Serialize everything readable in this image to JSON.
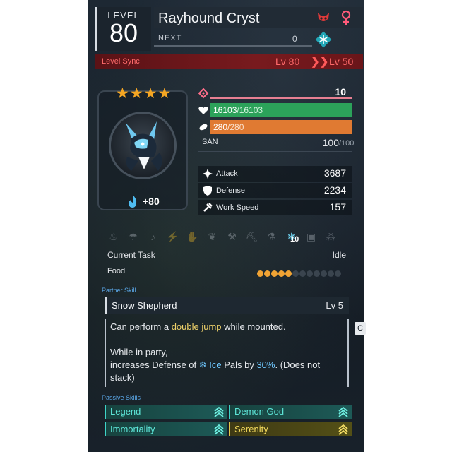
{
  "header": {
    "level_label": "LEVEL",
    "level": "80",
    "name": "Rayhound Cryst",
    "next_label": "NEXT",
    "next_value": "0",
    "element_icon": "ice-element-icon",
    "gender_icon": "female-icon",
    "type_icon": "aggressive-demon-icon"
  },
  "level_sync": {
    "label": "Level Sync",
    "from": "Lv 80",
    "to": "Lv 50",
    "arrow": "❯❯"
  },
  "portrait": {
    "stars": "★★★★",
    "soul_bonus": "+80"
  },
  "stats": {
    "trust_value": "10",
    "hp_current": "16103",
    "hp_max": "/16103",
    "food_current": "280",
    "food_max": "/280",
    "san_label": "SAN",
    "san_current": "100",
    "san_max": "/100",
    "attack_label": "Attack",
    "attack_value": "3687",
    "defense_label": "Defense",
    "defense_value": "2234",
    "work_speed_label": "Work Speed",
    "work_speed_value": "157"
  },
  "work": {
    "active_level": "10",
    "current_task_label": "Current Task",
    "current_task_value": "Idle",
    "food_label": "Food",
    "food_filled": 5,
    "food_total": 12
  },
  "partner_skill": {
    "section_title": "Partner Skill",
    "name": "Snow Shepherd",
    "level": "Lv  5",
    "desc_1a": "Can perform a ",
    "desc_1b": "double jump",
    "desc_1c": " while mounted.",
    "desc_2": "While in party,",
    "desc_3a": "increases Defense of ",
    "desc_3b": "Ice",
    "desc_3c": " Pals by ",
    "desc_3d": "30%",
    "desc_3e": ".  (Does not",
    "desc_4": "stack)"
  },
  "passive_skills": {
    "section_title": "Passive Skills",
    "items": [
      {
        "name": "Legend",
        "tier": "blue"
      },
      {
        "name": "Demon God",
        "tier": "blue"
      },
      {
        "name": "Immortality",
        "tier": "blue"
      },
      {
        "name": "Serenity",
        "tier": "gold"
      }
    ]
  },
  "side_tab_label": "C",
  "colors": {
    "hp": "#2ca25a",
    "food": "#e07a32",
    "level_sync": "#781a1e",
    "ice_accent": "#6fc8ff",
    "rare_passive": "#3fd4c8",
    "gold_passive": "#e5c94a"
  }
}
